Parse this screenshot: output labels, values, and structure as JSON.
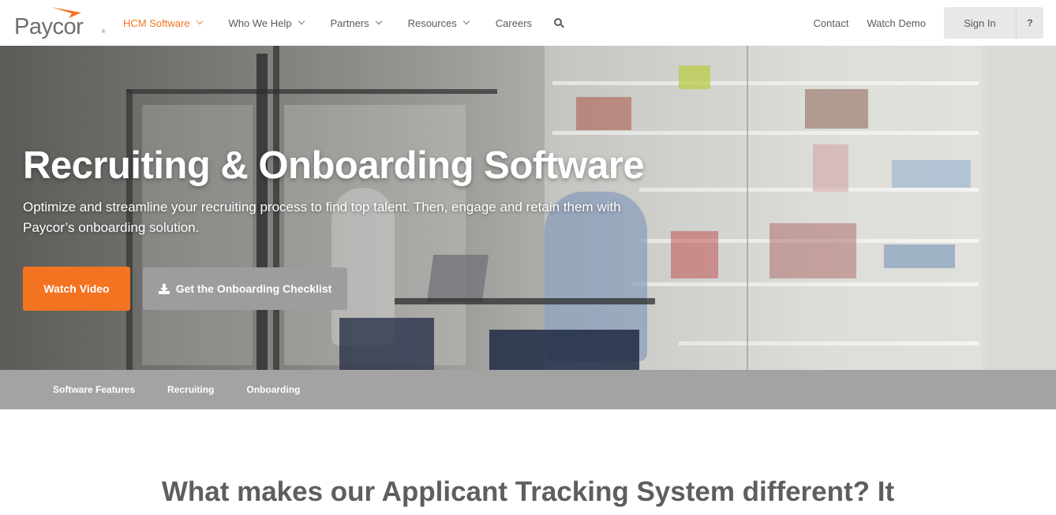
{
  "brand": {
    "name": "Paycor",
    "accent_color": "#f47321"
  },
  "header": {
    "nav_left": [
      {
        "label": "HCM Software",
        "has_dropdown": true,
        "active": true
      },
      {
        "label": "Who We Help",
        "has_dropdown": true,
        "active": false
      },
      {
        "label": "Partners",
        "has_dropdown": true,
        "active": false
      },
      {
        "label": "Resources",
        "has_dropdown": true,
        "active": false
      },
      {
        "label": "Careers",
        "has_dropdown": false,
        "active": false
      }
    ],
    "search_icon": "search-icon",
    "nav_right": [
      {
        "label": "Contact"
      },
      {
        "label": "Watch Demo"
      }
    ],
    "sign_in_label": "Sign In",
    "help_label": "?"
  },
  "hero": {
    "title": "Recruiting & Onboarding Software",
    "subtitle": "Optimize and streamline your recruiting process to find top talent. Then, engage and retain them with Paycor’s onboarding solution.",
    "primary_button": "Watch Video",
    "secondary_button": "Get the Onboarding Checklist",
    "secondary_icon": "download-icon"
  },
  "subnav": {
    "items": [
      "Software Features",
      "Recruiting",
      "Onboarding"
    ]
  },
  "content": {
    "section_title": "What makes our Applicant Tracking System different? It"
  }
}
